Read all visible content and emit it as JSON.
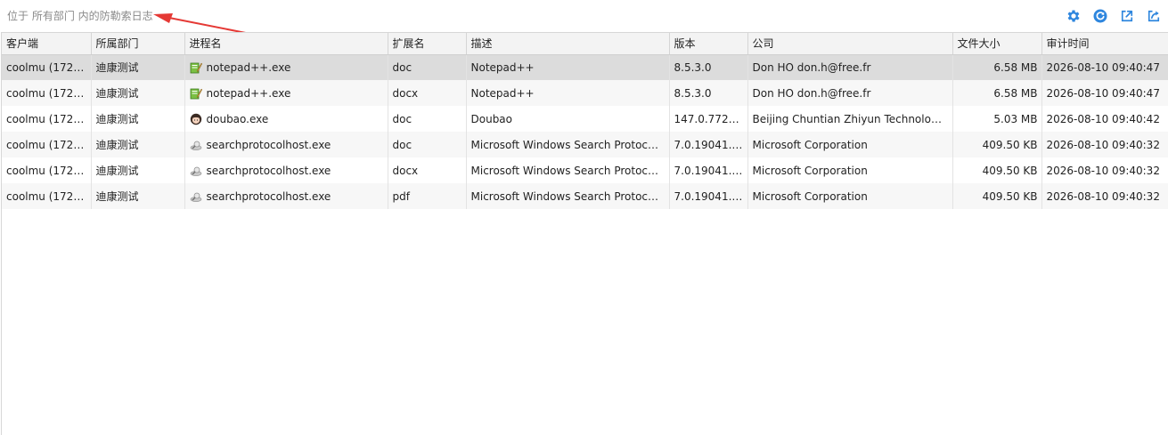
{
  "header": {
    "location_text": "位于 所有部门 内的防勒索日志"
  },
  "toolbar": {
    "buttons": [
      {
        "name": "settings",
        "icon": "gear-icon"
      },
      {
        "name": "refresh",
        "icon": "refresh-icon"
      },
      {
        "name": "export",
        "icon": "export-icon"
      },
      {
        "name": "share",
        "icon": "share-icon"
      }
    ],
    "accent": "#2e86de"
  },
  "annotation_color": "#e53935",
  "table": {
    "columns": [
      "客户端",
      "所属部门",
      "进程名",
      "扩展名",
      "描述",
      "版本",
      "公司",
      "文件大小",
      "审计时间"
    ],
    "rows": [
      {
        "client": "coolmu (172.1...",
        "dept": "迪康测试",
        "icon": "notepad-icon",
        "process": "notepad++.exe",
        "ext": "doc",
        "desc": "Notepad++",
        "version": "8.5.3.0",
        "company": "Don HO don.h@free.fr",
        "size": "6.58 MB",
        "time": "2026-08-10 09:40:47"
      },
      {
        "client": "coolmu (172.1...",
        "dept": "迪康测试",
        "icon": "notepad-icon",
        "process": "notepad++.exe",
        "ext": "docx",
        "desc": "Notepad++",
        "version": "8.5.3.0",
        "company": "Don HO don.h@free.fr",
        "size": "6.58 MB",
        "time": "2026-08-10 09:40:47"
      },
      {
        "client": "coolmu (172.1...",
        "dept": "迪康测试",
        "icon": "doubao-icon",
        "process": "doubao.exe",
        "ext": "doc",
        "desc": "Doubao",
        "version": "147.0.7727....",
        "company": "Beijing Chuntian Zhiyun Technology ...",
        "size": "5.03 MB",
        "time": "2026-08-10 09:40:42"
      },
      {
        "client": "coolmu (172.1...",
        "dept": "迪康测试",
        "icon": "search-protocol-icon",
        "process": "searchprotocolhost.exe",
        "ext": "doc",
        "desc": "Microsoft Windows Search Protocol...",
        "version": "7.0.19041.6...",
        "company": "Microsoft Corporation",
        "size": "409.50 KB",
        "time": "2026-08-10 09:40:32"
      },
      {
        "client": "coolmu (172.1...",
        "dept": "迪康测试",
        "icon": "search-protocol-icon",
        "process": "searchprotocolhost.exe",
        "ext": "docx",
        "desc": "Microsoft Windows Search Protocol...",
        "version": "7.0.19041.6...",
        "company": "Microsoft Corporation",
        "size": "409.50 KB",
        "time": "2026-08-10 09:40:32"
      },
      {
        "client": "coolmu (172.1...",
        "dept": "迪康测试",
        "icon": "search-protocol-icon",
        "process": "searchprotocolhost.exe",
        "ext": "pdf",
        "desc": "Microsoft Windows Search Protocol...",
        "version": "7.0.19041.6...",
        "company": "Microsoft Corporation",
        "size": "409.50 KB",
        "time": "2026-08-10 09:40:32"
      }
    ]
  }
}
